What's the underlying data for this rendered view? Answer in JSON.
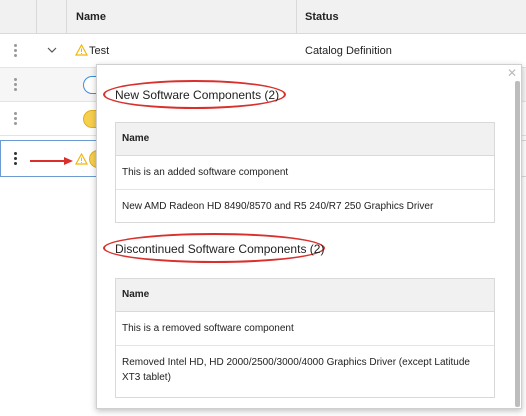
{
  "grid": {
    "columns": [
      {
        "label": "Name"
      },
      {
        "label": "Status"
      }
    ],
    "rows": [
      {
        "label": "Test",
        "status": "Catalog Definition"
      }
    ]
  },
  "popup": {
    "close_icon": "close-icon",
    "new_section": {
      "title": "New Software Components (2)",
      "header": "Name",
      "items": [
        "This is an added software component",
        "New AMD Radeon HD 8490/8570 and R5 240/R7 250 Graphics Driver"
      ]
    },
    "discontinued_section": {
      "title": "Discontinued Software Components (2)",
      "header": "Name",
      "items": [
        "This is a removed software component",
        "Removed Intel HD, HD 2000/2500/3000/4000 Graphics Driver (except Latitude XT3 tablet)"
      ]
    }
  },
  "colors": {
    "annotation_red": "#d9302c",
    "warning_yellow": "#f2b705",
    "pill_blue_border": "#3b8fd9",
    "pill_yellow": "#f7cf4f",
    "selection_border": "#6b9bd1"
  }
}
